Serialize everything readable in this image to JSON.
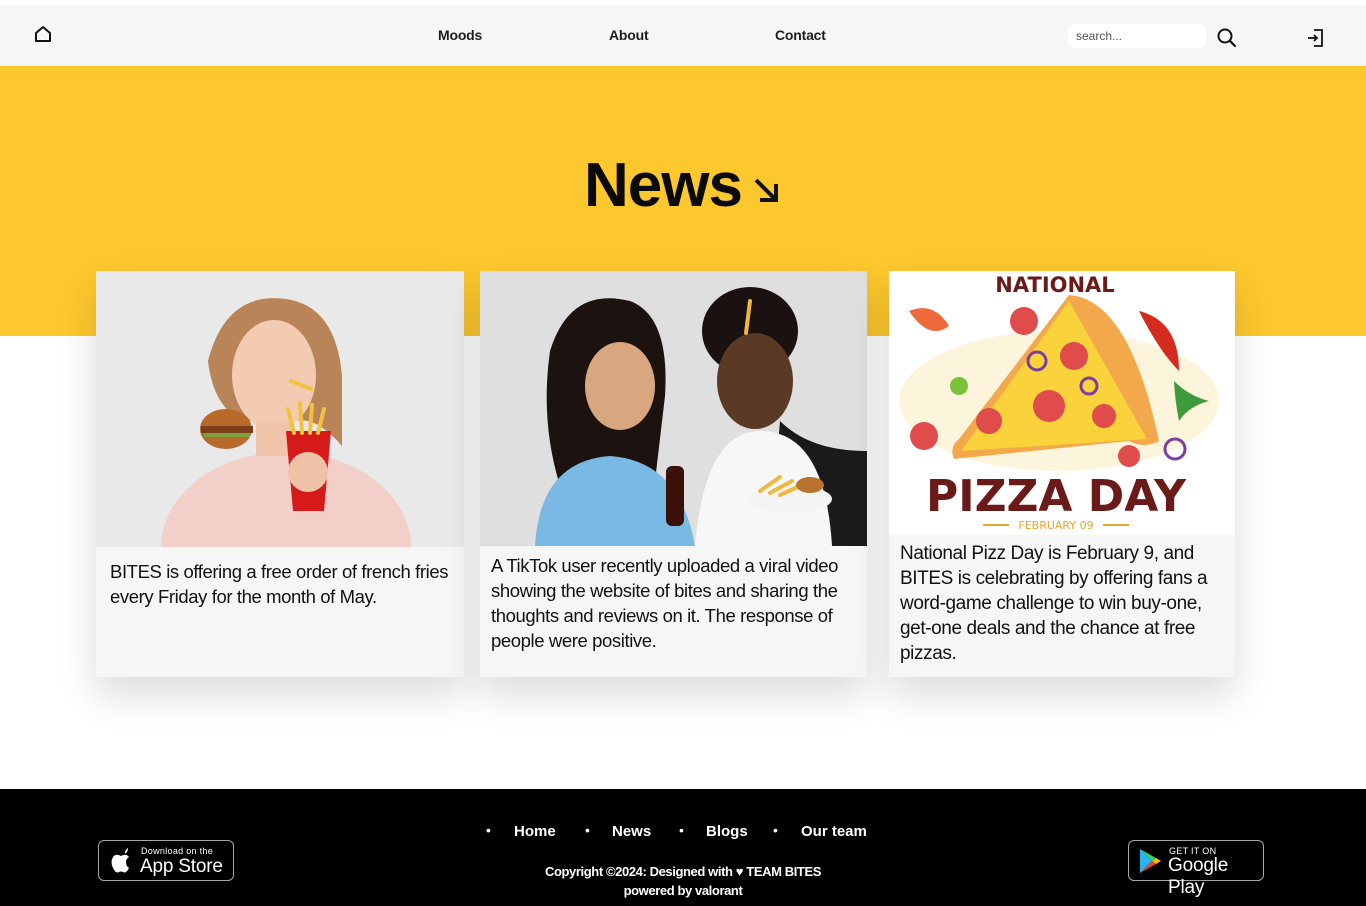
{
  "header": {
    "nav": [
      {
        "label": "Moods"
      },
      {
        "label": "About"
      },
      {
        "label": "Contact"
      }
    ],
    "search": {
      "placeholder": "search..."
    }
  },
  "hero": {
    "title": "News"
  },
  "cards": [
    {
      "text": "BITES is offering a free order of french fries every Friday for the month of May."
    },
    {
      "text": "A TikTok user recently uploaded a viral video showing the website of bites and sharing the thoughts and reviews on it. The response of people were positive."
    },
    {
      "text": "National Pizz Day is February 9, and BITES is celebrating by offering fans a word-game challenge to win buy-one, get-one deals and the chance at free pizzas.",
      "poster": {
        "top": "NATIONAL",
        "main": "PIZZA DAY",
        "date": "FEBRUARY 09"
      }
    }
  ],
  "footer": {
    "links": [
      {
        "label": "Home"
      },
      {
        "label": "News"
      },
      {
        "label": "Blogs"
      },
      {
        "label": "Our team"
      }
    ],
    "copyright": "Copyright ©2024: Designed with ♥ TEAM BITES",
    "powered": "powered by valorant",
    "app_store": {
      "small": "Download on the",
      "big": "App Store"
    },
    "google_play": {
      "small": "GET IT ON",
      "big": "Google Play"
    }
  },
  "colors": {
    "accent": "#fdc72e",
    "header_bg": "#f6f6f6",
    "footer_bg": "#000000",
    "card_bg": "#f6f6f6"
  }
}
